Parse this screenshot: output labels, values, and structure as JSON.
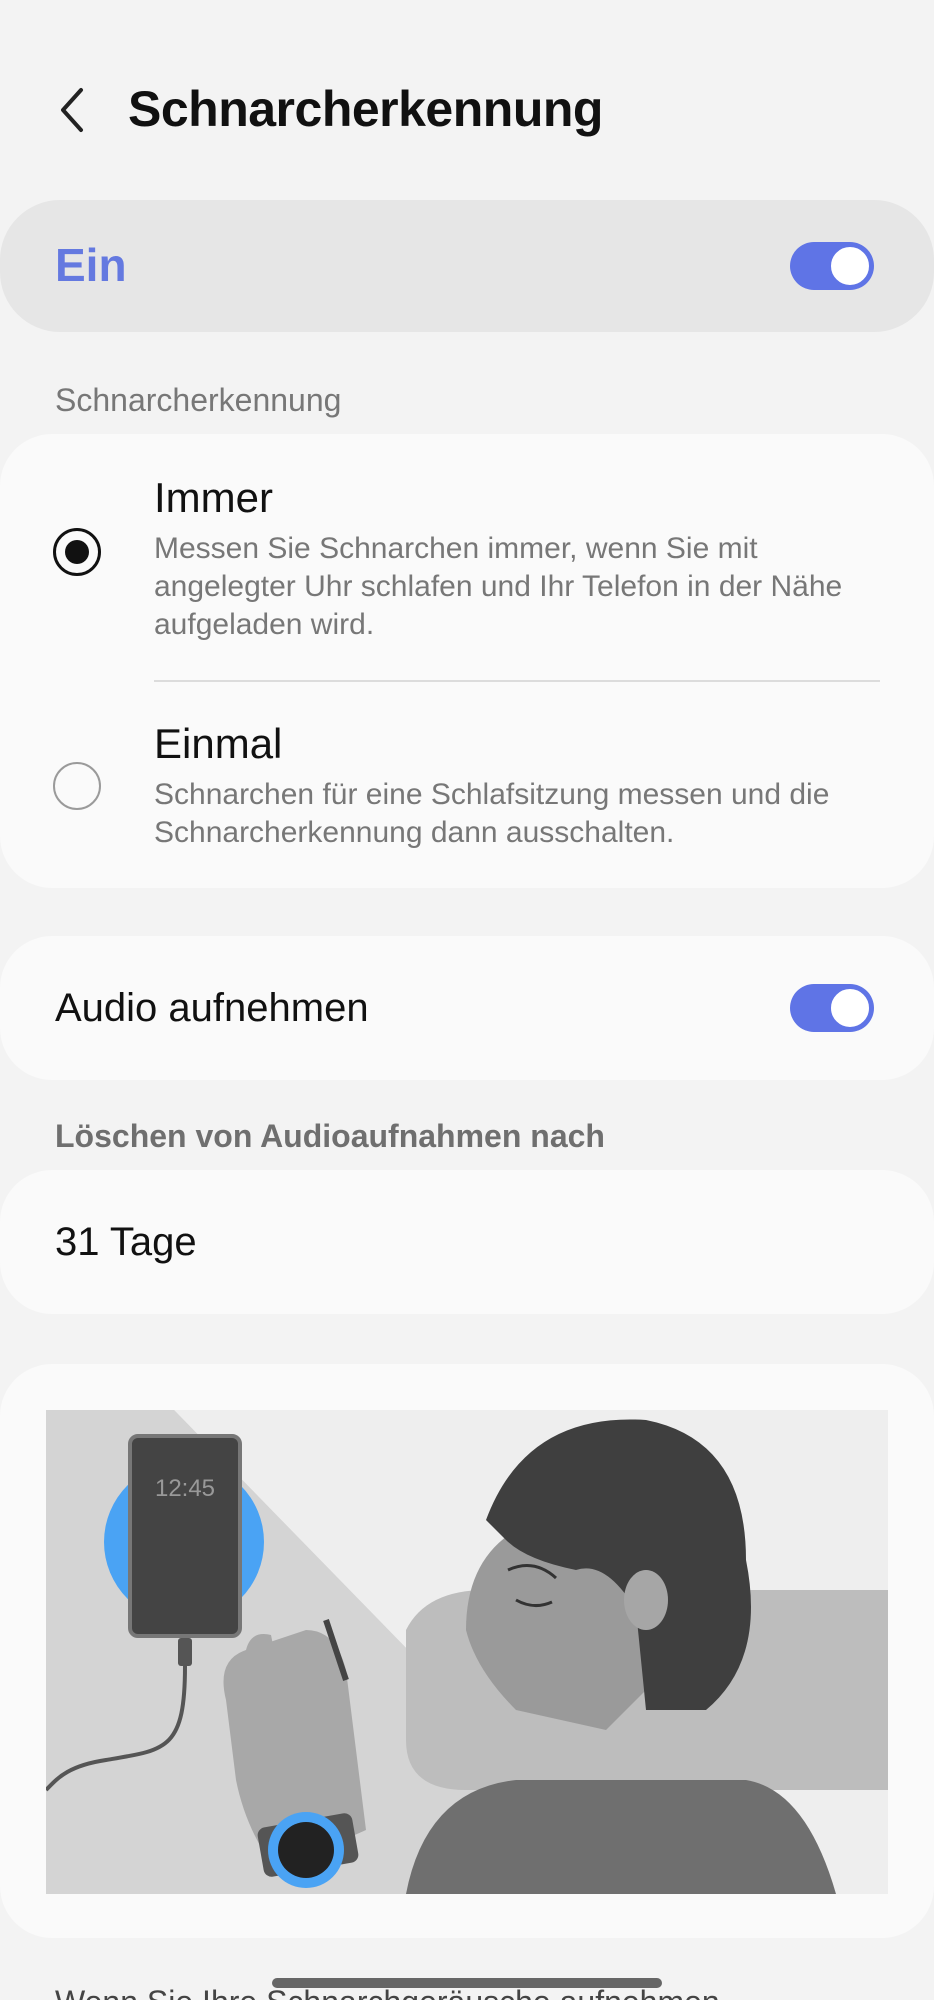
{
  "header": {
    "title": "Schnarcherkennung",
    "back_icon": "chevron-left-icon"
  },
  "master_switch": {
    "label": "Ein",
    "state": "on",
    "accent_color": "#5f74e6"
  },
  "detection_section": {
    "header": "Schnarcherkennung",
    "options": [
      {
        "title": "Immer",
        "description": "Messen Sie Schnarchen immer, wenn Sie mit angelegter Uhr schlafen und Ihr Telefon in der Nähe aufgeladen wird.",
        "selected": true
      },
      {
        "title": "Einmal",
        "description": "Schnarchen für eine Schlafsitzung messen und die Schnarcherkennung dann ausschalten.",
        "selected": false
      }
    ]
  },
  "audio": {
    "label": "Audio aufnehmen",
    "state": "on"
  },
  "delete_section": {
    "header": "Löschen von Audioaufnahmen nach",
    "value": "31 Tage"
  },
  "illustration": {
    "clock_text": "12:45",
    "description_icon": "sleeping-person-illustration"
  },
  "footer": {
    "partial_text": "Wenn Sie Ihre Schnarchgeräusche aufnehmen"
  }
}
